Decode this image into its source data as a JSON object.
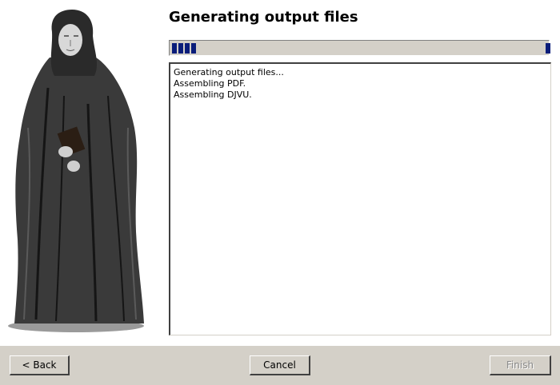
{
  "wizard": {
    "title": "Generating output files",
    "progress": {
      "percent": 4
    },
    "log_lines": [
      "Generating output files...",
      "Assembling PDF.",
      "Assembling DJVU."
    ],
    "side_image": {
      "subject": "monk-engraving"
    }
  },
  "buttons": {
    "back": "< Back",
    "cancel": "Cancel",
    "finish": "Finish"
  },
  "colors": {
    "progress_fill": "#0a1d7a",
    "dialog_bg": "#d4d0c8"
  }
}
